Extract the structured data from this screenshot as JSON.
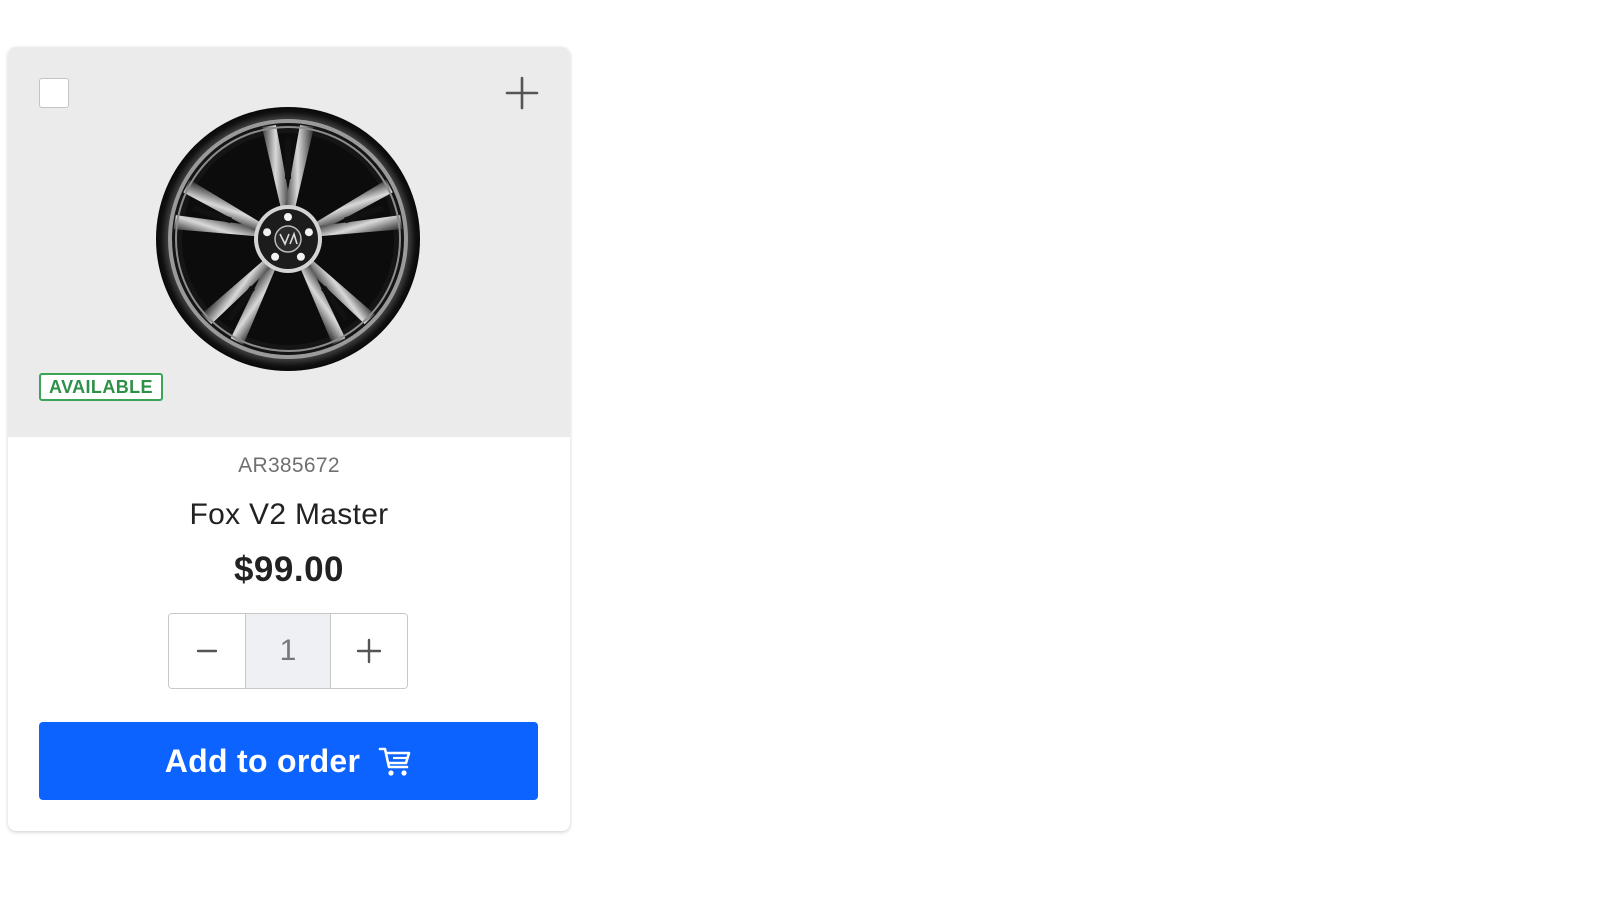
{
  "product": {
    "badge": "AVAILABLE",
    "sku": "AR385672",
    "name": "Fox V2 Master",
    "price": "$99.00",
    "quantity": "1",
    "add_button_label": "Add to order",
    "image_alt": "alloy wheel",
    "selected": false
  },
  "icons": {
    "expand": "plus-icon",
    "decrease": "minus-icon",
    "increase": "plus-icon",
    "cart": "shopping-cart-icon",
    "wheel": "wheel-image"
  },
  "colors": {
    "accent": "#0d63ff",
    "badge_green": "#2e8f47",
    "media_bg": "#ebebeb"
  }
}
